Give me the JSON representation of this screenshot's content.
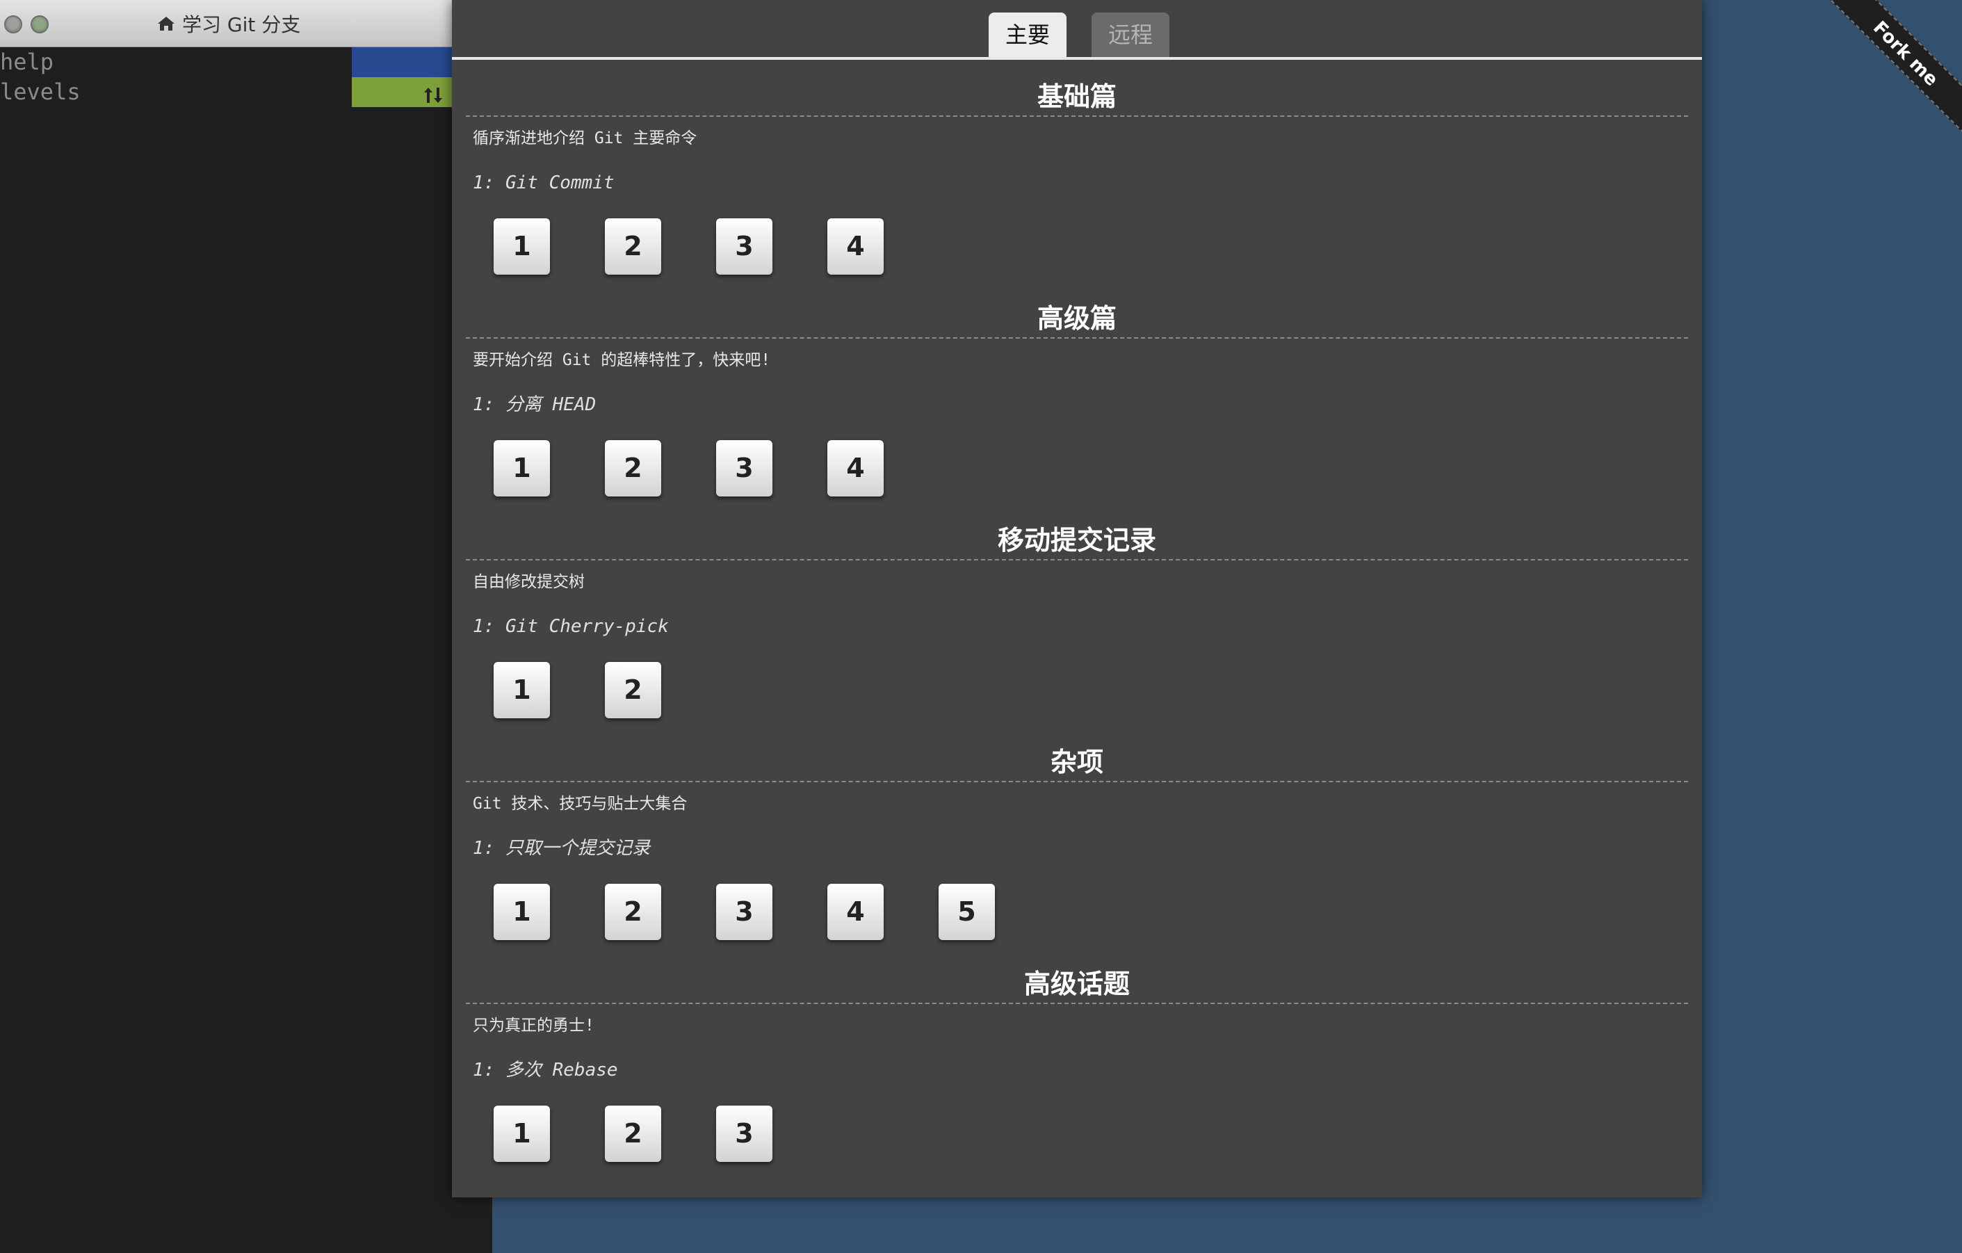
{
  "terminal": {
    "title": "学习 Git 分支",
    "lines": [
      {
        "text": "help",
        "bar_color": "#274a91"
      },
      {
        "text": "levels",
        "bar_color": "#7ea03a"
      }
    ]
  },
  "tabs": {
    "main": "主要",
    "remote": "远程",
    "active": "main"
  },
  "sections": [
    {
      "title": "基础篇",
      "description": "循序渐进地介绍 Git 主要命令",
      "subtitle": "1: Git Commit",
      "levels": [
        "1",
        "2",
        "3",
        "4"
      ]
    },
    {
      "title": "高级篇",
      "description": "要开始介绍 Git 的超棒特性了，快来吧!",
      "subtitle": "1: 分离 HEAD",
      "levels": [
        "1",
        "2",
        "3",
        "4"
      ]
    },
    {
      "title": "移动提交记录",
      "description": "自由修改提交树",
      "subtitle": "1: Git Cherry-pick",
      "levels": [
        "1",
        "2"
      ]
    },
    {
      "title": "杂项",
      "description": "Git 技术、技巧与贴士大集合",
      "subtitle": "1: 只取一个提交记录",
      "levels": [
        "1",
        "2",
        "3",
        "4",
        "5"
      ]
    },
    {
      "title": "高级话题",
      "description": "只为真正的勇士!",
      "subtitle": "1: 多次 Rebase",
      "levels": [
        "1",
        "2",
        "3"
      ]
    }
  ],
  "ribbon": "Fork me",
  "colors": {
    "panel_bg": "#434343",
    "terminal_bg": "#1e1e1e",
    "desktop_bg": "#34506f"
  }
}
